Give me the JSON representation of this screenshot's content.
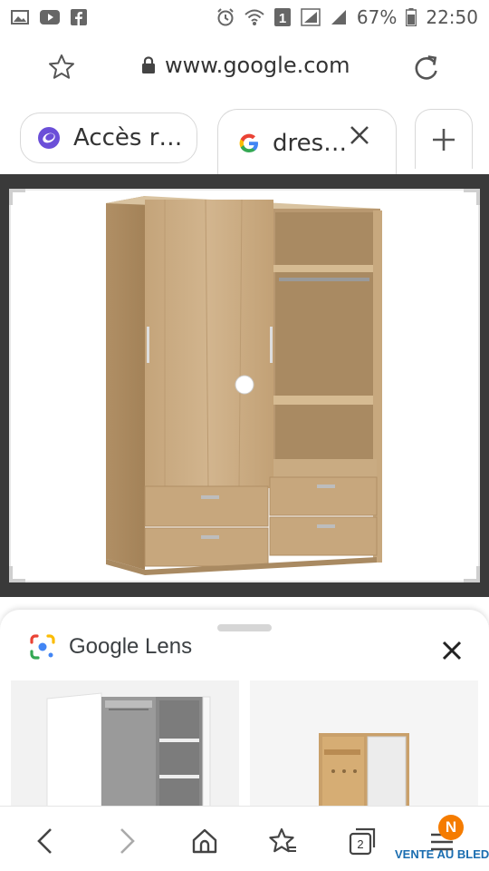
{
  "status_bar": {
    "battery_percent": "67%",
    "time": "22:50",
    "sim_label": "1"
  },
  "address_bar": {
    "url": "www.google.com"
  },
  "tabs": [
    {
      "label": "Accès r…"
    },
    {
      "label": "dres…"
    },
    {
      "label": "+"
    }
  ],
  "lens": {
    "title": "Google Lens"
  },
  "bottom_nav": {
    "tab_count": "2",
    "menu_badge": "N"
  },
  "watermark": "VENTE AU BLED",
  "colors": {
    "accent_orange": "#f57c00",
    "tab_icon_purple": "#6b4fd8",
    "wood": "#c9ab82",
    "image_band": "#3a3a3a"
  }
}
